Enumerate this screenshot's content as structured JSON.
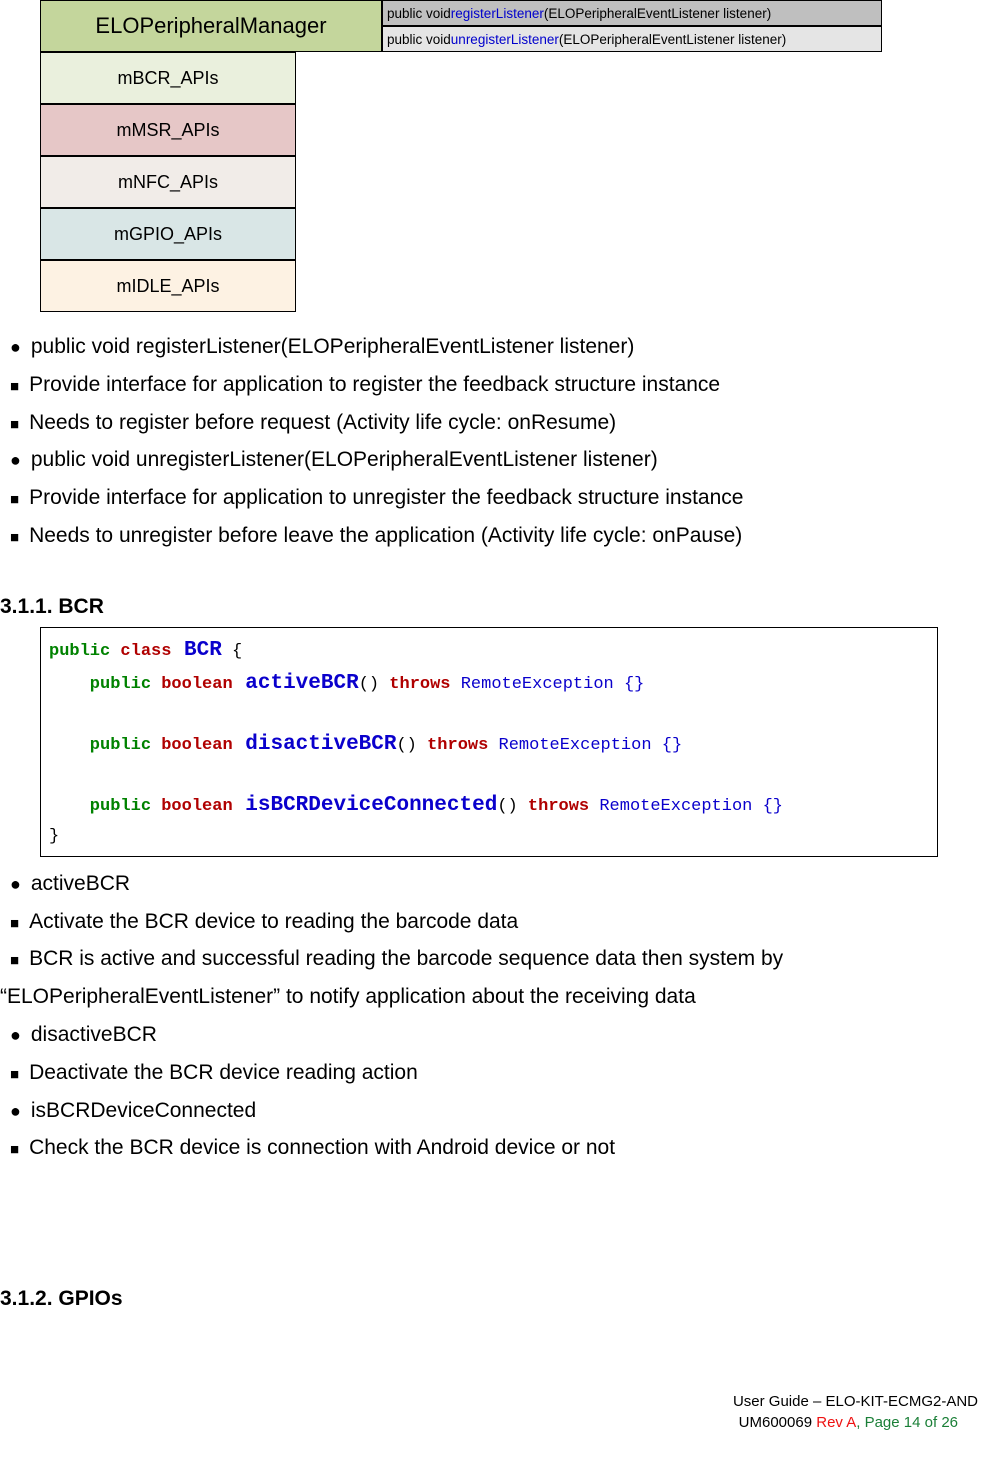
{
  "diagram": {
    "manager": "ELOPeripheralManager",
    "sig1_pre": "public void ",
    "sig1_method": "registerListener",
    "sig1_post": "(ELOPeripheralEventListener listener)",
    "sig2_pre": "public void ",
    "sig2_method": "unregisterListener",
    "sig2_post": "(ELOPeripheralEventListener listener)",
    "apis": {
      "bcr": "mBCR_APIs",
      "msr": "mMSR_APIs",
      "nfc": "mNFC_APIs",
      "gpio": "mGPIO_APIs",
      "idle": "mIDLE_APIs"
    }
  },
  "list1": {
    "a": "public void registerListener(ELOPeripheralEventListener listener)",
    "b": "Provide interface for application to register the feedback structure instance",
    "c": "Needs to register before request (Activity life cycle: onResume)",
    "d": "public void unregisterListener(ELOPeripheralEventListener listener)",
    "e": "Provide interface for application to unregister the feedback structure instance",
    "f": "Needs to unregister before leave the application (Activity life cycle: onPause)"
  },
  "section311": "3.1.1. BCR",
  "code": {
    "l1a": "public",
    "l1b": " class",
    "l1c": " BCR",
    "l1d": " {",
    "l2a": "    public",
    "l2b": " boolean",
    "l2c": " activeBCR",
    "l2d": "()",
    "l2e": " throws",
    "l2f": " RemoteException {}",
    "l3a": "    public",
    "l3b": " boolean",
    "l3c": " disactiveBCR",
    "l3d": "()",
    "l3e": " throws",
    "l3f": " RemoteException {}",
    "l4a": "    public",
    "l4b": " boolean",
    "l4c": " isBCRDeviceConnected",
    "l4d": "()",
    "l4e": " throws",
    "l4f": " RemoteException {}",
    "l5": "}"
  },
  "list2": {
    "a": "activeBCR",
    "b": "Activate the BCR device to reading the barcode data",
    "c": "BCR is active and successful reading the barcode sequence data then system by",
    "c2": "“ELOPeripheralEventListener” to notify application about the receiving data",
    "d": "disactiveBCR",
    "e": "Deactivate the BCR device reading action",
    "f": "isBCRDeviceConnected",
    "g": "Check the BCR device is connection with Android device or not"
  },
  "section312": "3.1.2. GPIOs",
  "footer": {
    "line1": "User Guide – ELO-KIT-ECMG2-AND",
    "line2a": "UM600069",
    "line2b": " Rev A",
    "line2c": ", Page 14 of 26"
  }
}
